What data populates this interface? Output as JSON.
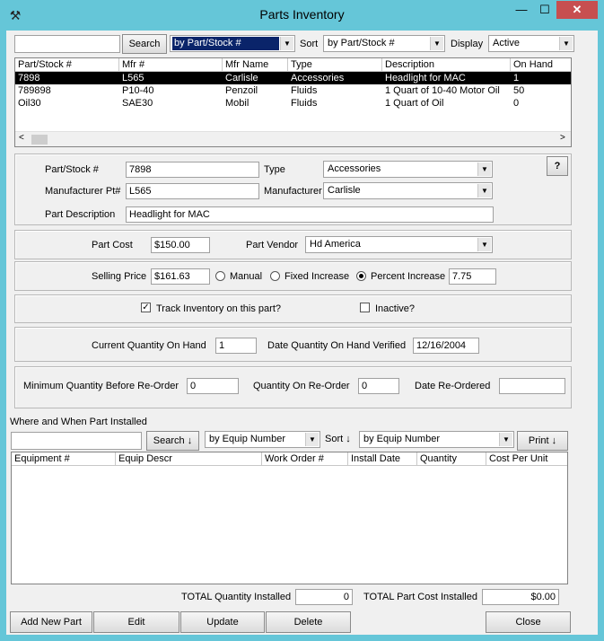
{
  "window": {
    "title": "Parts Inventory",
    "minimize": "—",
    "maximize": "☐",
    "close": "✕",
    "icon": "wrench-icon"
  },
  "top_search": {
    "search_value": "",
    "search_label": "Search",
    "search_by": "by Part/Stock #",
    "sort_label": "Sort",
    "sort_value": "by Part/Stock #",
    "display_label": "Display",
    "display_value": "Active"
  },
  "parts_table": {
    "columns": [
      "Part/Stock #",
      "Mfr #",
      "Mfr Name",
      "Type",
      "Description",
      "On Hand"
    ],
    "rows": [
      [
        "7898",
        "L565",
        "Carlisle",
        "Accessories",
        "Headlight for MAC",
        "1"
      ],
      [
        "789898",
        "P10-40",
        "Penzoil",
        "Fluids",
        "1 Quart of 10-40 Motor Oil",
        "50"
      ],
      [
        "Oil30",
        "SAE30",
        "Mobil",
        "Fluids",
        "1 Quart of Oil",
        "0"
      ]
    ]
  },
  "part_detail": {
    "part_stock_label": "Part/Stock #",
    "part_stock_value": "7898",
    "type_label": "Type",
    "type_value": "Accessories",
    "mfr_pt_label": "Manufacturer Pt#",
    "mfr_pt_value": "L565",
    "manufacturer_label": "Manufacturer",
    "manufacturer_value": "Carlisle",
    "description_label": "Part Description",
    "description_value": "Headlight for MAC",
    "help_glyph": "?"
  },
  "cost": {
    "part_cost_label": "Part Cost",
    "part_cost_value": "$150.00",
    "vendor_label": "Part Vendor",
    "vendor_value": "Hd America"
  },
  "pricing": {
    "selling_price_label": "Selling Price",
    "selling_price_value": "$161.63",
    "manual_label": "Manual",
    "fixed_label": "Fixed Increase",
    "percent_label": "Percent Increase",
    "percent_value": "7.75"
  },
  "tracking": {
    "track_label": "Track Inventory on this part?",
    "inactive_label": "Inactive?"
  },
  "quantity": {
    "current_label": "Current Quantity On Hand",
    "current_value": "1",
    "verified_label": "Date Quantity On Hand Verified",
    "verified_value": "12/16/2004"
  },
  "reorder": {
    "minimum_label": "Minimum Quantity Before Re-Order",
    "minimum_value": "0",
    "on_reorder_label": "Quantity On Re-Order",
    "on_reorder_value": "0",
    "date_label": "Date Re-Ordered",
    "date_value": ""
  },
  "installed": {
    "section_label": "Where and When Part Installed",
    "search_value": "",
    "search_label": "Search ↓",
    "search_by": "by Equip Number",
    "sort_label": "Sort ↓",
    "sort_value": "by Equip Number",
    "print_label": "Print ↓",
    "columns": [
      "Equipment #",
      "Equip Descr",
      "Work Order #",
      "Install Date",
      "Quantity",
      "Cost Per Unit"
    ],
    "total_qty_label": "TOTAL Quantity Installed",
    "total_qty_value": "0",
    "total_cost_label": "TOTAL Part Cost Installed",
    "total_cost_value": "$0.00"
  },
  "actions": {
    "add_label": "Add New Part",
    "edit_label": "Edit",
    "update_label": "Update",
    "delete_label": "Delete",
    "close_label": "Close"
  },
  "colors": {
    "frame": "#65c6d8",
    "close_button": "#c74f50",
    "selection": "#0a246a"
  }
}
